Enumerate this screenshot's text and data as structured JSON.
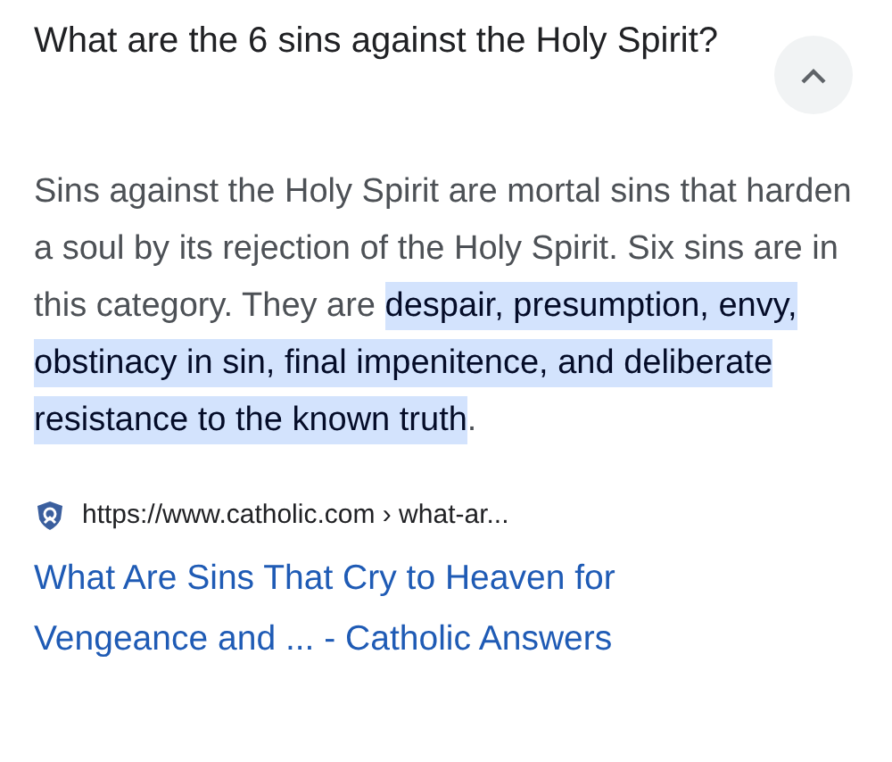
{
  "question": {
    "title": "What are the 6 sins against the Holy Spirit?",
    "expanded": true
  },
  "answer": [
    {
      "text": "Sins against the Holy Spirit are mortal sins that harden a soul by its rejection of the Holy Spirit. Six sins are in this category. They are ",
      "highlighted": false
    },
    {
      "text": "despair, presumption, envy, obstinacy in sin, final impenitence, and deliberate resistance to the known truth",
      "highlighted": true
    },
    {
      "text": ".",
      "highlighted": false
    }
  ],
  "source": {
    "url": "https://www.catholic.com › what-ar...",
    "title": "What Are Sins That Cry to Heaven for Vengeance and ... - Catholic Answers"
  }
}
